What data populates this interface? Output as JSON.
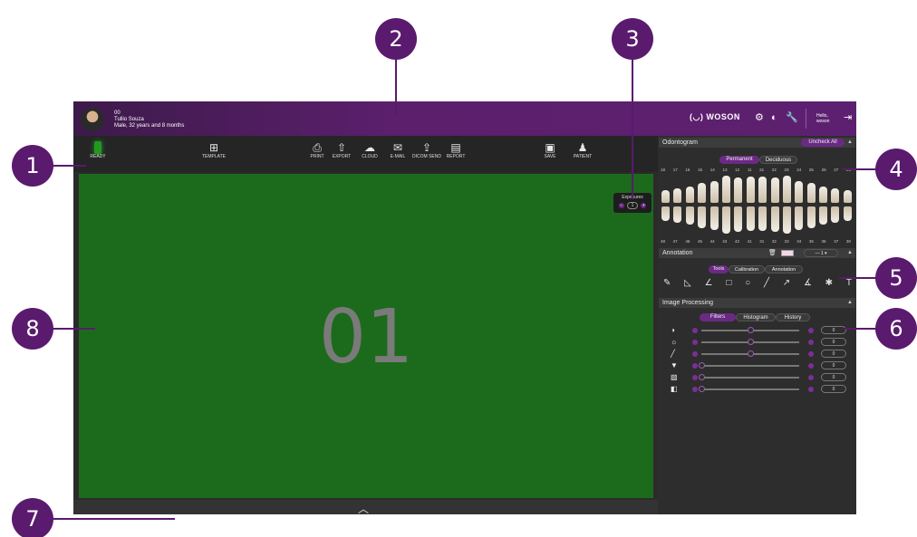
{
  "patient": {
    "id": "00",
    "name": "Tullio Souza",
    "details": "Male, 32 years and 8 months"
  },
  "brand": "WOSON",
  "greeting": "Hello, woson",
  "toolbar": {
    "ready": "READY",
    "template": "TEMPLATE",
    "print": "PRINT",
    "export": "EXPORT",
    "cloud": "CLOUD",
    "email": "E-MAIL",
    "dicom_send": "DICOM SEND",
    "report": "REPORT",
    "save": "SAVE",
    "patient": "PATIENT"
  },
  "viewer": {
    "image_label": "01",
    "exposures_label": "Exposures",
    "exposures_value": "1"
  },
  "odontogram": {
    "title": "Odontogram",
    "uncheck_all": "Uncheck All",
    "tabs": [
      "Permanent",
      "Deciduous"
    ],
    "upper_numbers": [
      "18",
      "17",
      "16",
      "15",
      "14",
      "13",
      "12",
      "11",
      "21",
      "22",
      "23",
      "24",
      "25",
      "26",
      "27",
      "28"
    ],
    "lower_numbers": [
      "48",
      "47",
      "46",
      "45",
      "44",
      "43",
      "42",
      "41",
      "31",
      "32",
      "33",
      "34",
      "35",
      "36",
      "37",
      "38"
    ]
  },
  "annotation": {
    "title": "Annotation",
    "line_width": "1",
    "tabs": [
      "Tools",
      "Calibration",
      "Annotation"
    ],
    "text_tool": "T"
  },
  "image_processing": {
    "title": "Image Processing",
    "tabs": [
      "Filters",
      "Histogram",
      "History"
    ],
    "filters": [
      {
        "icon": "contrast-icon",
        "value": "0",
        "level": 0.5
      },
      {
        "icon": "brightness-icon",
        "value": "0",
        "level": 0.5
      },
      {
        "icon": "gamma-icon",
        "value": "0",
        "level": 0.5
      },
      {
        "icon": "sharpen-icon",
        "value": "0",
        "level": 0.0
      },
      {
        "icon": "gradient-icon",
        "value": "0",
        "level": 0.0
      },
      {
        "icon": "invert-icon",
        "value": "0",
        "level": 0.0
      }
    ]
  },
  "callouts": [
    "1",
    "2",
    "3",
    "4",
    "5",
    "6",
    "7",
    "8"
  ],
  "colors": {
    "accent": "#5a1a6e",
    "viewer_bg": "#1c6b1c",
    "ready": "#1f9a1f"
  }
}
